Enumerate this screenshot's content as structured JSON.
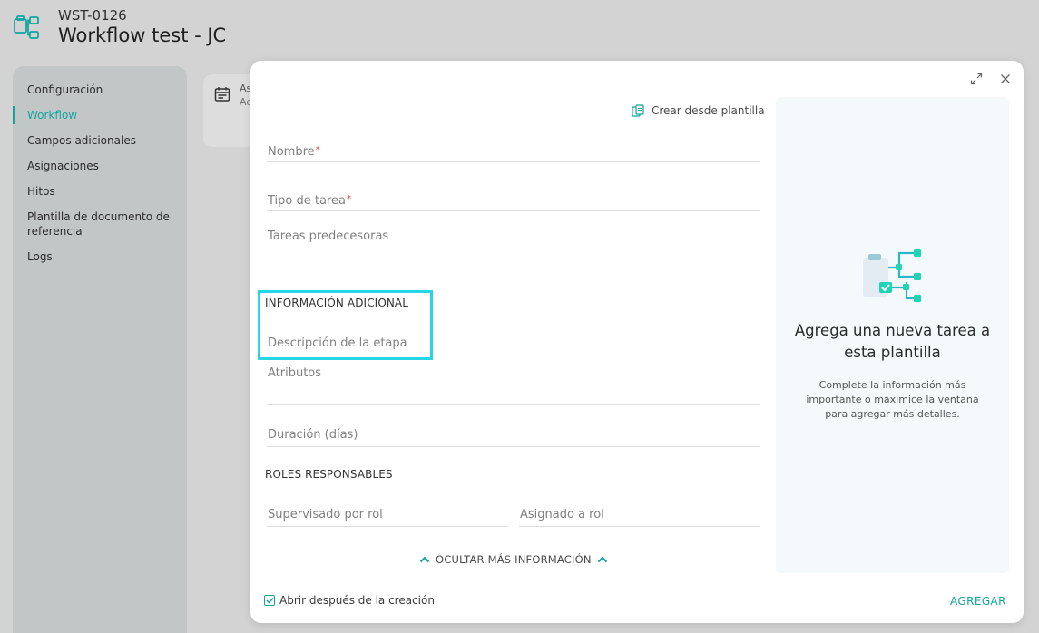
{
  "header": {
    "code": "WST-0126",
    "title": "Workflow test - JC"
  },
  "sidebar": {
    "items": [
      {
        "label": "Configuración",
        "active": false
      },
      {
        "label": "Workflow",
        "active": true
      },
      {
        "label": "Campos adicionales",
        "active": false
      },
      {
        "label": "Asignaciones",
        "active": false
      },
      {
        "label": "Hitos",
        "active": false
      },
      {
        "label": "Plantilla de documento de referencia",
        "active": false
      },
      {
        "label": "Logs",
        "active": false
      }
    ]
  },
  "background_card": {
    "line1": "As",
    "line2": "Ac"
  },
  "modal": {
    "template_link": "Crear desde plantilla",
    "fields": {
      "nombre": {
        "label": "Nombre",
        "required_mark": "*",
        "value": ""
      },
      "tipo_tarea": {
        "label": "Tipo de tarea",
        "required_mark": "*",
        "value": ""
      },
      "tareas_predecesoras": {
        "label": "Tareas predecesoras",
        "value": ""
      },
      "descripcion": {
        "label": "Descripción de la etapa",
        "value": ""
      },
      "atributos": {
        "label": "Atributos",
        "value": ""
      },
      "duracion": {
        "label": "Duración (días)",
        "value": ""
      },
      "supervisado": {
        "label": "Supervisado por rol",
        "value": ""
      },
      "asignado": {
        "label": "Asignado a rol",
        "value": ""
      }
    },
    "sections": {
      "info_adicional": "INFORMACIÓN ADICIONAL",
      "roles": "ROLES RESPONSABLES"
    },
    "toggle_more": "OCULTAR MÁS INFORMACIÓN",
    "open_after": {
      "label": "Abrir después de la creación",
      "checked": true
    },
    "submit": "AGREGAR",
    "panel": {
      "title": "Agrega una nueva tarea a esta plantilla",
      "text": "Complete la información más importante o maximice la ventana para agregar más detalles."
    }
  },
  "colors": {
    "accent": "#12a5a0",
    "highlight": "#27d6e6",
    "required": "#e04040"
  }
}
